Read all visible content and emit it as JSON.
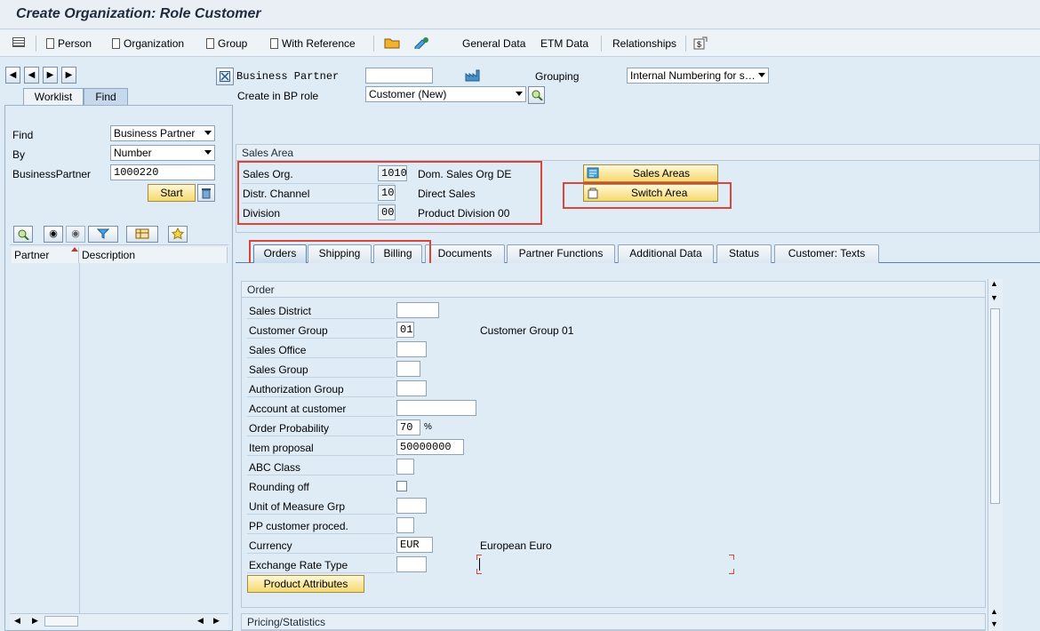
{
  "title": "Create Organization: Role Customer",
  "toolbar": {
    "person": "Person",
    "organization": "Organization",
    "group": "Group",
    "with_reference": "With Reference",
    "general_data": "General Data",
    "etm_data": "ETM Data",
    "relationships": "Relationships"
  },
  "left": {
    "tabs": [
      "Worklist",
      "Find"
    ],
    "find_label": "Find",
    "find_value": "Business Partner",
    "by_label": "By",
    "by_value": "Number",
    "bp_label": "BusinessPartner",
    "bp_value": "1000220",
    "start": "Start",
    "columns": [
      "Partner",
      "Description"
    ]
  },
  "header": {
    "bp_label": "Business Partner",
    "bp_value": "",
    "grouping_label": "Grouping",
    "grouping_value": "Internal Numbering for s…",
    "create_in_label": "Create in BP role",
    "create_in_value": "Customer (New)"
  },
  "sales_area": {
    "title": "Sales Area",
    "rows": [
      {
        "label": "Sales Org.",
        "code": "1010",
        "desc": "Dom. Sales Org DE"
      },
      {
        "label": "Distr. Channel",
        "code": "10",
        "desc": "Direct Sales"
      },
      {
        "label": "Division",
        "code": "00",
        "desc": "Product Division 00"
      }
    ],
    "sales_areas_btn": "Sales Areas",
    "switch_area_btn": "Switch Area"
  },
  "tabs": [
    "Orders",
    "Shipping",
    "Billing",
    "Documents",
    "Partner Functions",
    "Additional Data",
    "Status",
    "Customer: Texts"
  ],
  "order": {
    "title": "Order",
    "fields": [
      {
        "label": "Sales District",
        "value": ""
      },
      {
        "label": "Customer Group",
        "value": "01",
        "desc": "Customer Group 01"
      },
      {
        "label": "Sales Office",
        "value": ""
      },
      {
        "label": "Sales Group",
        "value": ""
      },
      {
        "label": "Authorization Group",
        "value": ""
      },
      {
        "label": "Account at customer",
        "value": ""
      },
      {
        "label": "Order Probability",
        "value": "70",
        "unit": "%"
      },
      {
        "label": "Item proposal",
        "value": "50000000"
      },
      {
        "label": "ABC Class",
        "value": ""
      },
      {
        "label": "Rounding off",
        "value": ""
      },
      {
        "label": "Unit of Measure Grp",
        "value": ""
      },
      {
        "label": "PP customer proced.",
        "value": ""
      },
      {
        "label": "Currency",
        "value": "EUR",
        "desc": "European Euro"
      },
      {
        "label": "Exchange Rate Type",
        "value": ""
      }
    ],
    "product_attributes_btn": "Product Attributes"
  },
  "pricing_title": "Pricing/Statistics"
}
